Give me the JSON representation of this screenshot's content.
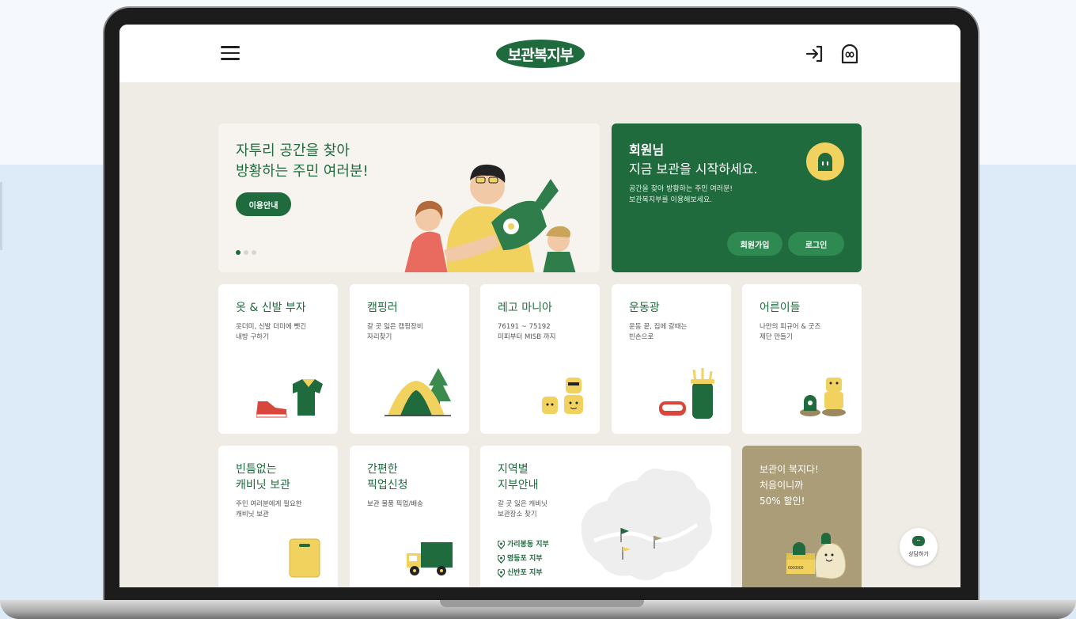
{
  "header": {
    "logo_text": "보관복지부",
    "menu_icon": "hamburger-menu-icon",
    "login_icon": "login-arrow-icon",
    "mascot_icon": "mascot-icon"
  },
  "hero": {
    "title_line1": "자투리 공간을 찾아",
    "title_line2": "방황하는 주민 여러분!",
    "button_label": "이용안내",
    "slide_index": 1,
    "slide_count": 3
  },
  "member": {
    "title_line1": "회원님",
    "title_line2": "지금 보관을 시작하세요.",
    "desc_line1": "공간을 찾아 방황하는 주민 여러분!",
    "desc_line2": "보관복지부를 이용해보세요.",
    "join_label": "회원가입",
    "login_label": "로그인"
  },
  "categories": [
    {
      "title": "옷 & 신발 부자",
      "desc1": "옷더미, 신발 더미에 뺏긴",
      "desc2": "내방 구하기"
    },
    {
      "title": "캠핑러",
      "desc1": "갈 곳 잃은 캠핑장비",
      "desc2": "자리찾기"
    },
    {
      "title": "레고 마니아",
      "desc1": "76191 ~ 75192",
      "desc2": "미피부터 MISB 까지"
    },
    {
      "title": "운동광",
      "desc1": "운동 끝, 집에 갈때는",
      "desc2": "빈손으로"
    },
    {
      "title": "어른이들",
      "desc1": "나만의 피규어 & 굿즈",
      "desc2": "제단 만들기"
    }
  ],
  "services": {
    "cabinet": {
      "title1": "빈틈없는",
      "title2": "캐비닛 보관",
      "desc1": "주민 여러분에게 필요한",
      "desc2": "캐비닛 보관"
    },
    "pickup": {
      "title1": "간편한",
      "title2": "픽업신청",
      "desc1": "보관 물품 픽업/배송"
    },
    "branches": {
      "title1": "지역별",
      "title2": "지부안내",
      "desc1": "갈 곳 잃은 캐비닛",
      "desc2": "보관장소 찾기",
      "items": [
        "가리봉동 지부",
        "영등포 지부",
        "신반포 지부"
      ]
    },
    "promo": {
      "line1": "보관이 복지다!",
      "line2": "처음이니까",
      "line3": "50% 할인!",
      "box_label": "0000000"
    }
  },
  "chat": {
    "label": "상담하기"
  },
  "colors": {
    "brand_green": "#1f6b3e",
    "accent_yellow": "#f1d25e",
    "promo_tan": "#ab9d77",
    "page_bg": "#efebe5"
  }
}
